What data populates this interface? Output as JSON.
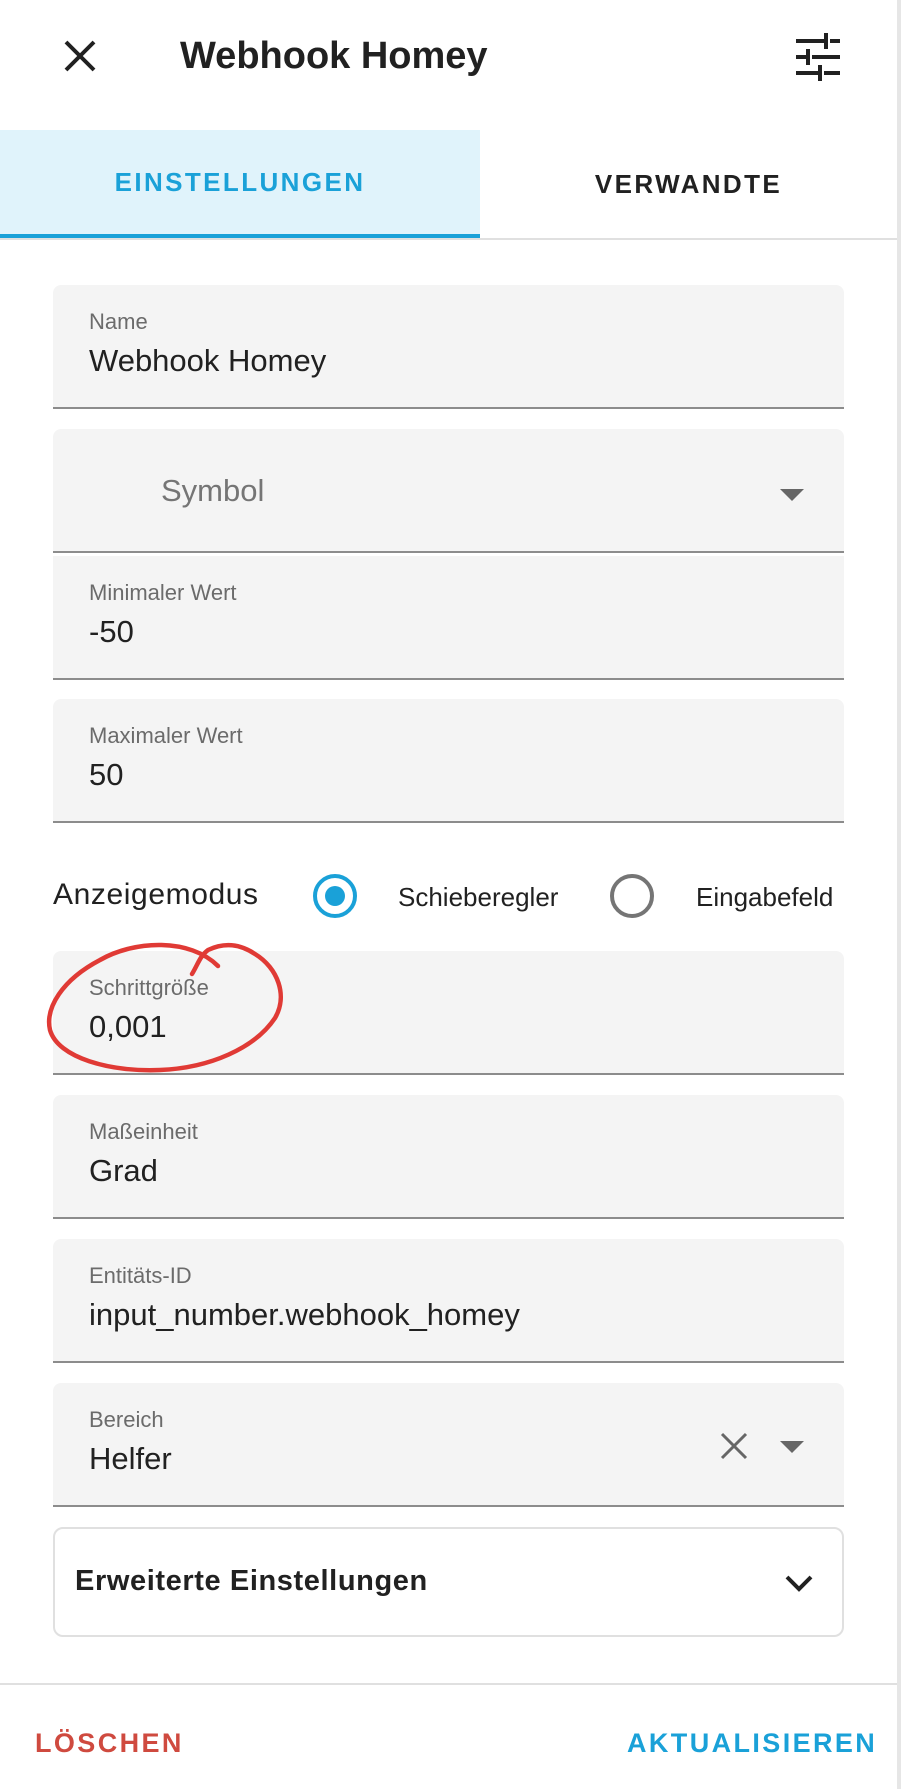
{
  "header": {
    "title": "Webhook Homey",
    "close_icon": "close-icon",
    "settings_icon": "tune-icon"
  },
  "tabs": [
    {
      "label": "EINSTELLUNGEN",
      "active": true
    },
    {
      "label": "VERWANDTE",
      "active": false
    }
  ],
  "form": {
    "name": {
      "label": "Name",
      "value": "Webhook Homey"
    },
    "symbol": {
      "placeholder": "Symbol"
    },
    "min": {
      "label": "Minimaler Wert",
      "value": "-50"
    },
    "max": {
      "label": "Maximaler Wert",
      "value": "50"
    },
    "display_mode": {
      "label": "Anzeigemodus",
      "options": [
        {
          "label": "Schieberegler",
          "checked": true
        },
        {
          "label": "Eingabefeld",
          "checked": false
        }
      ]
    },
    "step": {
      "label": "Schrittgröße",
      "value": "0,001"
    },
    "unit": {
      "label": "Maßeinheit",
      "value": "Grad"
    },
    "entity_id": {
      "label": "Entitäts-ID",
      "value": "input_number.webhook_homey"
    },
    "area": {
      "label": "Bereich",
      "value": "Helfer"
    },
    "advanced": {
      "label": "Erweiterte Einstellungen"
    }
  },
  "footer": {
    "delete_label": "LÖSCHEN",
    "update_label": "AKTUALISIEREN"
  },
  "colors": {
    "accent": "#1aa1d8",
    "danger": "#cf4a3f",
    "annotation": "#e03a35",
    "field_bg": "#f4f4f4",
    "tab_active_bg": "#e0f3fb"
  }
}
